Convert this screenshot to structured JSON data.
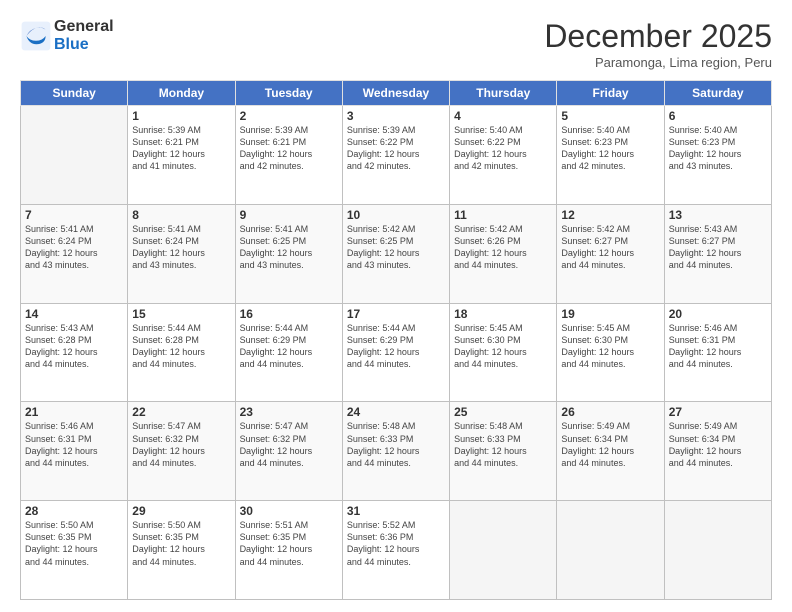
{
  "logo": {
    "general": "General",
    "blue": "Blue"
  },
  "title": "December 2025",
  "subtitle": "Paramonga, Lima region, Peru",
  "days_of_week": [
    "Sunday",
    "Monday",
    "Tuesday",
    "Wednesday",
    "Thursday",
    "Friday",
    "Saturday"
  ],
  "weeks": [
    [
      {
        "day": "",
        "info": ""
      },
      {
        "day": "1",
        "info": "Sunrise: 5:39 AM\nSunset: 6:21 PM\nDaylight: 12 hours\nand 41 minutes."
      },
      {
        "day": "2",
        "info": "Sunrise: 5:39 AM\nSunset: 6:21 PM\nDaylight: 12 hours\nand 42 minutes."
      },
      {
        "day": "3",
        "info": "Sunrise: 5:39 AM\nSunset: 6:22 PM\nDaylight: 12 hours\nand 42 minutes."
      },
      {
        "day": "4",
        "info": "Sunrise: 5:40 AM\nSunset: 6:22 PM\nDaylight: 12 hours\nand 42 minutes."
      },
      {
        "day": "5",
        "info": "Sunrise: 5:40 AM\nSunset: 6:23 PM\nDaylight: 12 hours\nand 42 minutes."
      },
      {
        "day": "6",
        "info": "Sunrise: 5:40 AM\nSunset: 6:23 PM\nDaylight: 12 hours\nand 43 minutes."
      }
    ],
    [
      {
        "day": "7",
        "info": "Sunrise: 5:41 AM\nSunset: 6:24 PM\nDaylight: 12 hours\nand 43 minutes."
      },
      {
        "day": "8",
        "info": "Sunrise: 5:41 AM\nSunset: 6:24 PM\nDaylight: 12 hours\nand 43 minutes."
      },
      {
        "day": "9",
        "info": "Sunrise: 5:41 AM\nSunset: 6:25 PM\nDaylight: 12 hours\nand 43 minutes."
      },
      {
        "day": "10",
        "info": "Sunrise: 5:42 AM\nSunset: 6:25 PM\nDaylight: 12 hours\nand 43 minutes."
      },
      {
        "day": "11",
        "info": "Sunrise: 5:42 AM\nSunset: 6:26 PM\nDaylight: 12 hours\nand 44 minutes."
      },
      {
        "day": "12",
        "info": "Sunrise: 5:42 AM\nSunset: 6:27 PM\nDaylight: 12 hours\nand 44 minutes."
      },
      {
        "day": "13",
        "info": "Sunrise: 5:43 AM\nSunset: 6:27 PM\nDaylight: 12 hours\nand 44 minutes."
      }
    ],
    [
      {
        "day": "14",
        "info": "Sunrise: 5:43 AM\nSunset: 6:28 PM\nDaylight: 12 hours\nand 44 minutes."
      },
      {
        "day": "15",
        "info": "Sunrise: 5:44 AM\nSunset: 6:28 PM\nDaylight: 12 hours\nand 44 minutes."
      },
      {
        "day": "16",
        "info": "Sunrise: 5:44 AM\nSunset: 6:29 PM\nDaylight: 12 hours\nand 44 minutes."
      },
      {
        "day": "17",
        "info": "Sunrise: 5:44 AM\nSunset: 6:29 PM\nDaylight: 12 hours\nand 44 minutes."
      },
      {
        "day": "18",
        "info": "Sunrise: 5:45 AM\nSunset: 6:30 PM\nDaylight: 12 hours\nand 44 minutes."
      },
      {
        "day": "19",
        "info": "Sunrise: 5:45 AM\nSunset: 6:30 PM\nDaylight: 12 hours\nand 44 minutes."
      },
      {
        "day": "20",
        "info": "Sunrise: 5:46 AM\nSunset: 6:31 PM\nDaylight: 12 hours\nand 44 minutes."
      }
    ],
    [
      {
        "day": "21",
        "info": "Sunrise: 5:46 AM\nSunset: 6:31 PM\nDaylight: 12 hours\nand 44 minutes."
      },
      {
        "day": "22",
        "info": "Sunrise: 5:47 AM\nSunset: 6:32 PM\nDaylight: 12 hours\nand 44 minutes."
      },
      {
        "day": "23",
        "info": "Sunrise: 5:47 AM\nSunset: 6:32 PM\nDaylight: 12 hours\nand 44 minutes."
      },
      {
        "day": "24",
        "info": "Sunrise: 5:48 AM\nSunset: 6:33 PM\nDaylight: 12 hours\nand 44 minutes."
      },
      {
        "day": "25",
        "info": "Sunrise: 5:48 AM\nSunset: 6:33 PM\nDaylight: 12 hours\nand 44 minutes."
      },
      {
        "day": "26",
        "info": "Sunrise: 5:49 AM\nSunset: 6:34 PM\nDaylight: 12 hours\nand 44 minutes."
      },
      {
        "day": "27",
        "info": "Sunrise: 5:49 AM\nSunset: 6:34 PM\nDaylight: 12 hours\nand 44 minutes."
      }
    ],
    [
      {
        "day": "28",
        "info": "Sunrise: 5:50 AM\nSunset: 6:35 PM\nDaylight: 12 hours\nand 44 minutes."
      },
      {
        "day": "29",
        "info": "Sunrise: 5:50 AM\nSunset: 6:35 PM\nDaylight: 12 hours\nand 44 minutes."
      },
      {
        "day": "30",
        "info": "Sunrise: 5:51 AM\nSunset: 6:35 PM\nDaylight: 12 hours\nand 44 minutes."
      },
      {
        "day": "31",
        "info": "Sunrise: 5:52 AM\nSunset: 6:36 PM\nDaylight: 12 hours\nand 44 minutes."
      },
      {
        "day": "",
        "info": ""
      },
      {
        "day": "",
        "info": ""
      },
      {
        "day": "",
        "info": ""
      }
    ]
  ]
}
